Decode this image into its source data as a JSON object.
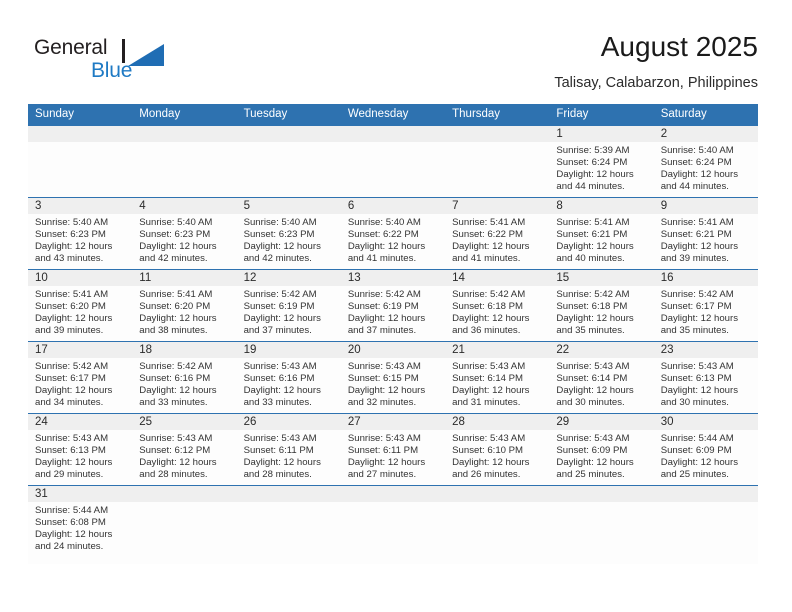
{
  "brand": {
    "name_top": "General",
    "name_bottom": "Blue",
    "accent_color": "#1f7ac4",
    "triangle_icon": "triangle-logo-icon"
  },
  "header": {
    "title": "August 2025",
    "subtitle": "Talisay, Calabarzon, Philippines"
  },
  "theme": {
    "header_blue": "#2e72b0",
    "daynum_band": "#efefef",
    "cell_background": "#fdfdfd",
    "text": "#333333"
  },
  "calendar": {
    "weekday_headers": [
      "Sunday",
      "Monday",
      "Tuesday",
      "Wednesday",
      "Thursday",
      "Friday",
      "Saturday"
    ],
    "labels": {
      "sunrise": "Sunrise:",
      "sunset": "Sunset:",
      "daylight": "Daylight:"
    },
    "weeks": [
      {
        "days": [
          {
            "num": "",
            "sunrise": "",
            "sunset": "",
            "daylight_a": "",
            "daylight_b": ""
          },
          {
            "num": "",
            "sunrise": "",
            "sunset": "",
            "daylight_a": "",
            "daylight_b": ""
          },
          {
            "num": "",
            "sunrise": "",
            "sunset": "",
            "daylight_a": "",
            "daylight_b": ""
          },
          {
            "num": "",
            "sunrise": "",
            "sunset": "",
            "daylight_a": "",
            "daylight_b": ""
          },
          {
            "num": "",
            "sunrise": "",
            "sunset": "",
            "daylight_a": "",
            "daylight_b": ""
          },
          {
            "num": "1",
            "sunrise": "Sunrise: 5:39 AM",
            "sunset": "Sunset: 6:24 PM",
            "daylight_a": "Daylight: 12 hours",
            "daylight_b": "and 44 minutes."
          },
          {
            "num": "2",
            "sunrise": "Sunrise: 5:40 AM",
            "sunset": "Sunset: 6:24 PM",
            "daylight_a": "Daylight: 12 hours",
            "daylight_b": "and 44 minutes."
          }
        ]
      },
      {
        "days": [
          {
            "num": "3",
            "sunrise": "Sunrise: 5:40 AM",
            "sunset": "Sunset: 6:23 PM",
            "daylight_a": "Daylight: 12 hours",
            "daylight_b": "and 43 minutes."
          },
          {
            "num": "4",
            "sunrise": "Sunrise: 5:40 AM",
            "sunset": "Sunset: 6:23 PM",
            "daylight_a": "Daylight: 12 hours",
            "daylight_b": "and 42 minutes."
          },
          {
            "num": "5",
            "sunrise": "Sunrise: 5:40 AM",
            "sunset": "Sunset: 6:23 PM",
            "daylight_a": "Daylight: 12 hours",
            "daylight_b": "and 42 minutes."
          },
          {
            "num": "6",
            "sunrise": "Sunrise: 5:40 AM",
            "sunset": "Sunset: 6:22 PM",
            "daylight_a": "Daylight: 12 hours",
            "daylight_b": "and 41 minutes."
          },
          {
            "num": "7",
            "sunrise": "Sunrise: 5:41 AM",
            "sunset": "Sunset: 6:22 PM",
            "daylight_a": "Daylight: 12 hours",
            "daylight_b": "and 41 minutes."
          },
          {
            "num": "8",
            "sunrise": "Sunrise: 5:41 AM",
            "sunset": "Sunset: 6:21 PM",
            "daylight_a": "Daylight: 12 hours",
            "daylight_b": "and 40 minutes."
          },
          {
            "num": "9",
            "sunrise": "Sunrise: 5:41 AM",
            "sunset": "Sunset: 6:21 PM",
            "daylight_a": "Daylight: 12 hours",
            "daylight_b": "and 39 minutes."
          }
        ]
      },
      {
        "days": [
          {
            "num": "10",
            "sunrise": "Sunrise: 5:41 AM",
            "sunset": "Sunset: 6:20 PM",
            "daylight_a": "Daylight: 12 hours",
            "daylight_b": "and 39 minutes."
          },
          {
            "num": "11",
            "sunrise": "Sunrise: 5:41 AM",
            "sunset": "Sunset: 6:20 PM",
            "daylight_a": "Daylight: 12 hours",
            "daylight_b": "and 38 minutes."
          },
          {
            "num": "12",
            "sunrise": "Sunrise: 5:42 AM",
            "sunset": "Sunset: 6:19 PM",
            "daylight_a": "Daylight: 12 hours",
            "daylight_b": "and 37 minutes."
          },
          {
            "num": "13",
            "sunrise": "Sunrise: 5:42 AM",
            "sunset": "Sunset: 6:19 PM",
            "daylight_a": "Daylight: 12 hours",
            "daylight_b": "and 37 minutes."
          },
          {
            "num": "14",
            "sunrise": "Sunrise: 5:42 AM",
            "sunset": "Sunset: 6:18 PM",
            "daylight_a": "Daylight: 12 hours",
            "daylight_b": "and 36 minutes."
          },
          {
            "num": "15",
            "sunrise": "Sunrise: 5:42 AM",
            "sunset": "Sunset: 6:18 PM",
            "daylight_a": "Daylight: 12 hours",
            "daylight_b": "and 35 minutes."
          },
          {
            "num": "16",
            "sunrise": "Sunrise: 5:42 AM",
            "sunset": "Sunset: 6:17 PM",
            "daylight_a": "Daylight: 12 hours",
            "daylight_b": "and 35 minutes."
          }
        ]
      },
      {
        "days": [
          {
            "num": "17",
            "sunrise": "Sunrise: 5:42 AM",
            "sunset": "Sunset: 6:17 PM",
            "daylight_a": "Daylight: 12 hours",
            "daylight_b": "and 34 minutes."
          },
          {
            "num": "18",
            "sunrise": "Sunrise: 5:42 AM",
            "sunset": "Sunset: 6:16 PM",
            "daylight_a": "Daylight: 12 hours",
            "daylight_b": "and 33 minutes."
          },
          {
            "num": "19",
            "sunrise": "Sunrise: 5:43 AM",
            "sunset": "Sunset: 6:16 PM",
            "daylight_a": "Daylight: 12 hours",
            "daylight_b": "and 33 minutes."
          },
          {
            "num": "20",
            "sunrise": "Sunrise: 5:43 AM",
            "sunset": "Sunset: 6:15 PM",
            "daylight_a": "Daylight: 12 hours",
            "daylight_b": "and 32 minutes."
          },
          {
            "num": "21",
            "sunrise": "Sunrise: 5:43 AM",
            "sunset": "Sunset: 6:14 PM",
            "daylight_a": "Daylight: 12 hours",
            "daylight_b": "and 31 minutes."
          },
          {
            "num": "22",
            "sunrise": "Sunrise: 5:43 AM",
            "sunset": "Sunset: 6:14 PM",
            "daylight_a": "Daylight: 12 hours",
            "daylight_b": "and 30 minutes."
          },
          {
            "num": "23",
            "sunrise": "Sunrise: 5:43 AM",
            "sunset": "Sunset: 6:13 PM",
            "daylight_a": "Daylight: 12 hours",
            "daylight_b": "and 30 minutes."
          }
        ]
      },
      {
        "days": [
          {
            "num": "24",
            "sunrise": "Sunrise: 5:43 AM",
            "sunset": "Sunset: 6:13 PM",
            "daylight_a": "Daylight: 12 hours",
            "daylight_b": "and 29 minutes."
          },
          {
            "num": "25",
            "sunrise": "Sunrise: 5:43 AM",
            "sunset": "Sunset: 6:12 PM",
            "daylight_a": "Daylight: 12 hours",
            "daylight_b": "and 28 minutes."
          },
          {
            "num": "26",
            "sunrise": "Sunrise: 5:43 AM",
            "sunset": "Sunset: 6:11 PM",
            "daylight_a": "Daylight: 12 hours",
            "daylight_b": "and 28 minutes."
          },
          {
            "num": "27",
            "sunrise": "Sunrise: 5:43 AM",
            "sunset": "Sunset: 6:11 PM",
            "daylight_a": "Daylight: 12 hours",
            "daylight_b": "and 27 minutes."
          },
          {
            "num": "28",
            "sunrise": "Sunrise: 5:43 AM",
            "sunset": "Sunset: 6:10 PM",
            "daylight_a": "Daylight: 12 hours",
            "daylight_b": "and 26 minutes."
          },
          {
            "num": "29",
            "sunrise": "Sunrise: 5:43 AM",
            "sunset": "Sunset: 6:09 PM",
            "daylight_a": "Daylight: 12 hours",
            "daylight_b": "and 25 minutes."
          },
          {
            "num": "30",
            "sunrise": "Sunrise: 5:44 AM",
            "sunset": "Sunset: 6:09 PM",
            "daylight_a": "Daylight: 12 hours",
            "daylight_b": "and 25 minutes."
          }
        ]
      },
      {
        "days": [
          {
            "num": "31",
            "sunrise": "Sunrise: 5:44 AM",
            "sunset": "Sunset: 6:08 PM",
            "daylight_a": "Daylight: 12 hours",
            "daylight_b": "and 24 minutes."
          },
          {
            "num": "",
            "sunrise": "",
            "sunset": "",
            "daylight_a": "",
            "daylight_b": ""
          },
          {
            "num": "",
            "sunrise": "",
            "sunset": "",
            "daylight_a": "",
            "daylight_b": ""
          },
          {
            "num": "",
            "sunrise": "",
            "sunset": "",
            "daylight_a": "",
            "daylight_b": ""
          },
          {
            "num": "",
            "sunrise": "",
            "sunset": "",
            "daylight_a": "",
            "daylight_b": ""
          },
          {
            "num": "",
            "sunrise": "",
            "sunset": "",
            "daylight_a": "",
            "daylight_b": ""
          },
          {
            "num": "",
            "sunrise": "",
            "sunset": "",
            "daylight_a": "",
            "daylight_b": ""
          }
        ]
      }
    ]
  }
}
